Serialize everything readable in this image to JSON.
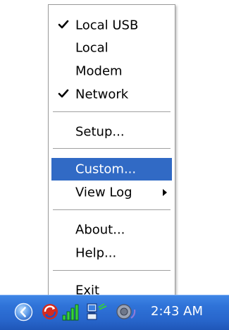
{
  "menu": {
    "items": [
      {
        "label": "Local USB",
        "checked": true
      },
      {
        "label": "Local",
        "checked": false
      },
      {
        "label": "Modem",
        "checked": false
      },
      {
        "label": "Network",
        "checked": true
      },
      {
        "label": "Setup...",
        "checked": false
      },
      {
        "label": "Custom...",
        "checked": false,
        "highlighted": true
      },
      {
        "label": "View Log",
        "checked": false,
        "submenu": true
      },
      {
        "label": "About...",
        "checked": false
      },
      {
        "label": "Help...",
        "checked": false
      },
      {
        "label": "Exit",
        "checked": false
      }
    ]
  },
  "tray": {
    "clock": "2:43 AM",
    "icons": [
      "show-hidden-icons-arrow-icon",
      "app-tray-icon",
      "signal-strength-icon",
      "network-connection-icon",
      "speaker-icon"
    ]
  },
  "colors": {
    "highlight": "#316ac5",
    "taskbar": "#2866cc"
  }
}
